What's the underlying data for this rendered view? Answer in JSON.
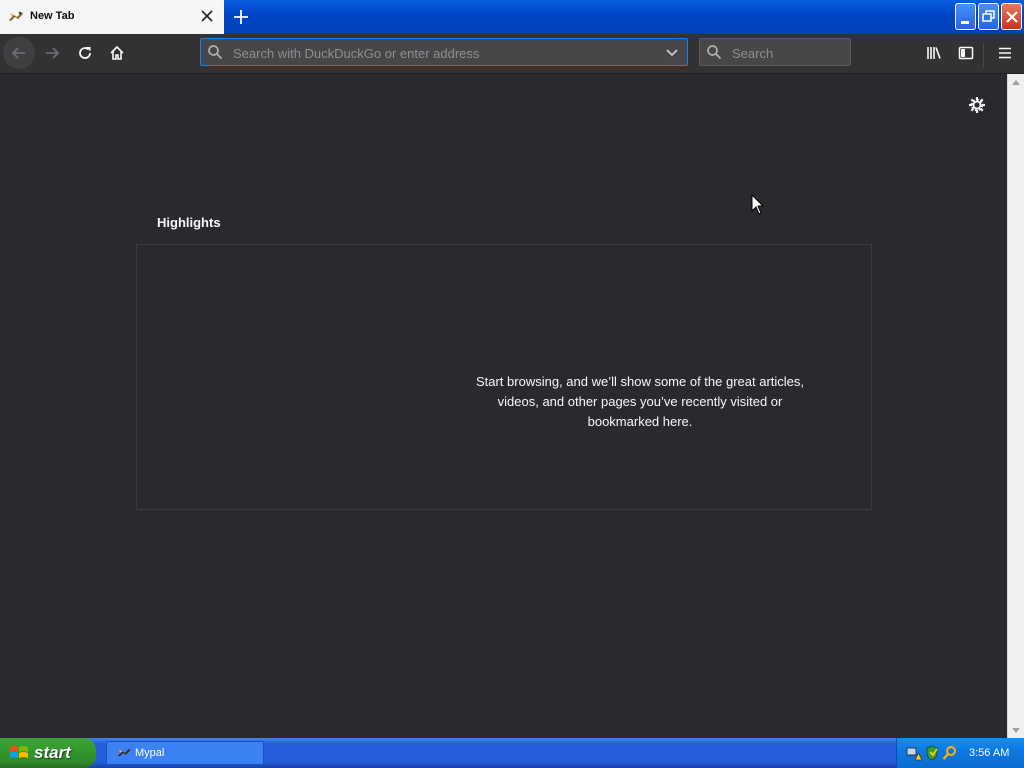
{
  "tab": {
    "title": "New Tab",
    "new_tab_icon": "plus-icon",
    "close_icon": "close-icon"
  },
  "window_controls": [
    "minimize-icon",
    "restore-icon",
    "close-icon"
  ],
  "toolbar": {
    "url_placeholder": "Search with DuckDuckGo or enter address",
    "search_placeholder": "Search",
    "icons": [
      "back-arrow-icon",
      "forward-arrow-icon",
      "reload-icon",
      "home-icon",
      "library-icon",
      "sidebar-icon",
      "hamburger-menu-icon"
    ]
  },
  "newtab": {
    "highlights_title": "Highlights",
    "empty_message": "Start browsing, and we’ll show some of the great articles, videos, and other pages you’ve recently visited or bookmarked here.",
    "settings_icon": "gear-icon"
  },
  "taskbar": {
    "start_label": "start",
    "task_label": "Mypal",
    "clock": "3:56 AM"
  },
  "colors": {
    "content_bg": "#2a2a2e",
    "toolbar_bg": "#323234",
    "titlebar_blue": "#0046c8",
    "accent": "#0a84ff"
  }
}
